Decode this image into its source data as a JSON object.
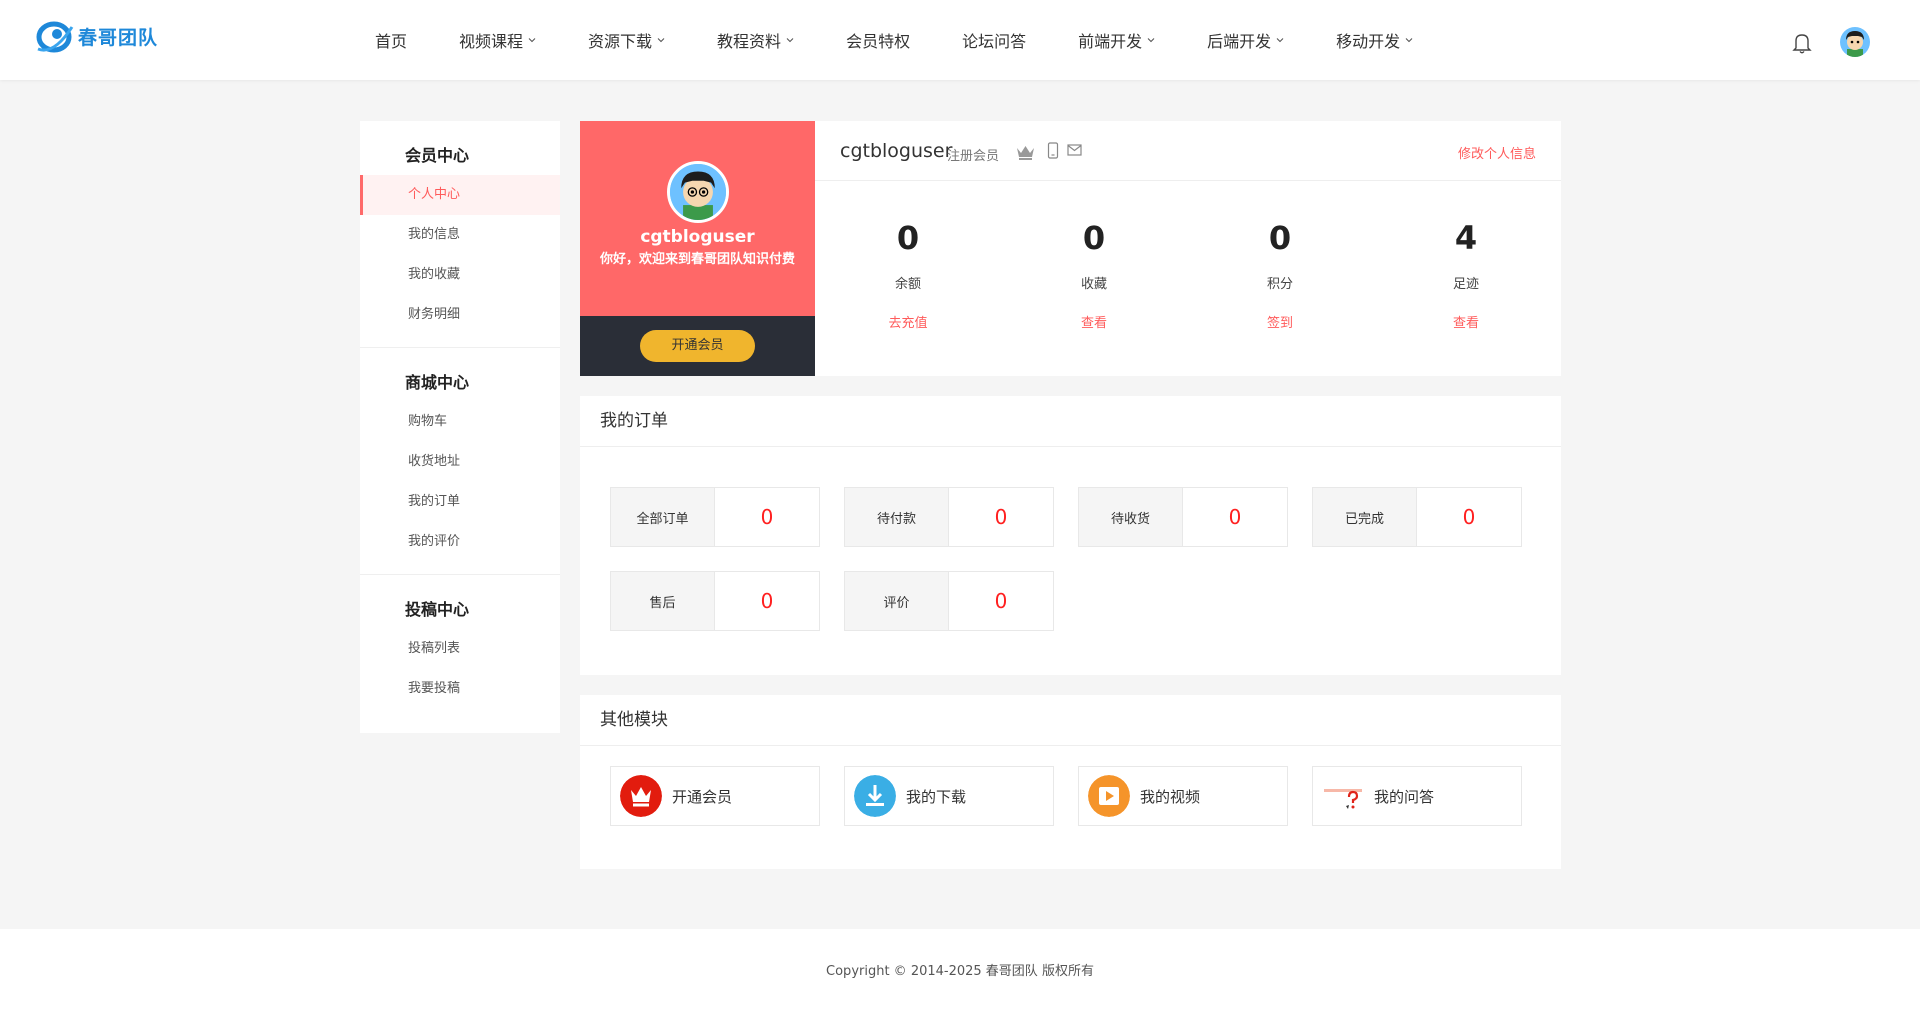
{
  "header": {
    "logo_text": "春哥团队",
    "nav": [
      {
        "label": "首页",
        "dropdown": false
      },
      {
        "label": "视频课程",
        "dropdown": true
      },
      {
        "label": "资源下载",
        "dropdown": true
      },
      {
        "label": "教程资料",
        "dropdown": true
      },
      {
        "label": "会员特权",
        "dropdown": false
      },
      {
        "label": "论坛问答",
        "dropdown": false
      },
      {
        "label": "前端开发",
        "dropdown": true
      },
      {
        "label": "后端开发",
        "dropdown": true
      },
      {
        "label": "移动开发",
        "dropdown": true
      }
    ]
  },
  "sidebar": {
    "groups": [
      {
        "title": "会员中心",
        "items": [
          "个人中心",
          "我的信息",
          "我的收藏",
          "财务明细"
        ]
      },
      {
        "title": "商城中心",
        "items": [
          "购物车",
          "收货地址",
          "我的订单",
          "我的评价"
        ]
      },
      {
        "title": "投稿中心",
        "items": [
          "投稿列表",
          "我要投稿"
        ]
      }
    ],
    "active_item": "个人中心"
  },
  "profile": {
    "username": "cgtbloguser",
    "welcome": "你好，欢迎来到春哥团队知识付费",
    "vip_button": "开通会员",
    "role": "注册会员",
    "edit_link": "修改个人信息",
    "card_color": "#ff6868",
    "stats": [
      {
        "value": "0",
        "label": "余额",
        "link": "去充值"
      },
      {
        "value": "0",
        "label": "收藏",
        "link": "查看"
      },
      {
        "value": "0",
        "label": "积分",
        "link": "签到"
      },
      {
        "value": "4",
        "label": "足迹",
        "link": "查看"
      }
    ]
  },
  "orders": {
    "title": "我的订单",
    "items": [
      {
        "label": "全部订单",
        "count": "0"
      },
      {
        "label": "待付款",
        "count": "0"
      },
      {
        "label": "待收货",
        "count": "0"
      },
      {
        "label": "已完成",
        "count": "0"
      },
      {
        "label": "售后",
        "count": "0"
      },
      {
        "label": "评价",
        "count": "0"
      }
    ]
  },
  "modules": {
    "title": "其他模块",
    "items": [
      {
        "label": "开通会员",
        "icon": "crown-icon"
      },
      {
        "label": "我的下载",
        "icon": "download-icon"
      },
      {
        "label": "我的视频",
        "icon": "play-icon"
      },
      {
        "label": "我的问答",
        "icon": "question-icon"
      }
    ]
  },
  "footer": {
    "copyright": "Copyright © 2014-2025 春哥团队 版权所有"
  },
  "colors": {
    "accent": "#ff5b5b",
    "vip_gold": "#f0b52d",
    "logo_blue": "#1e88d9"
  }
}
